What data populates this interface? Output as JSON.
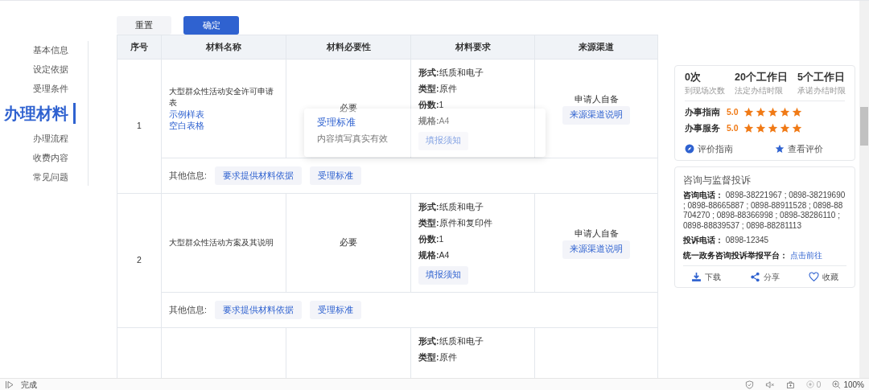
{
  "toolbar": {
    "buttons": [
      {
        "label": "重置",
        "kind": "secondary"
      },
      {
        "label": "确定",
        "kind": "primary"
      }
    ]
  },
  "sidebar": {
    "items": [
      {
        "label": "基本信息",
        "selected": false
      },
      {
        "label": "设定依据",
        "selected": false
      },
      {
        "label": "受理条件",
        "selected": false
      },
      {
        "label": "办理材料",
        "selected": true
      },
      {
        "label": "办理流程",
        "selected": false
      },
      {
        "label": "收费内容",
        "selected": false
      },
      {
        "label": "常见问题",
        "selected": false
      }
    ]
  },
  "table": {
    "columns": [
      "序号",
      "材料名称",
      "材料必要性",
      "材料要求",
      "来源渠道"
    ],
    "rows": [
      {
        "index": "1",
        "name": "大型群众性活动安全许可申请表",
        "links": [
          "示例样表",
          "空白表格"
        ],
        "necessity": "必要",
        "requirements": [
          "**形式:**纸质和电子",
          "**类型:**原件",
          "**份数:**1",
          "**规格:**A4"
        ],
        "requirement_button": "填报须知",
        "source": "申请人自备",
        "source_button": "来源渠道说明",
        "other_label": "其他信息:",
        "other_buttons": [
          "要求提供材料依据",
          "受理标准"
        ]
      },
      {
        "index": "2",
        "name": "大型群众性活动方案及其说明",
        "necessity": "必要",
        "requirements": [
          "**形式:**纸质和电子",
          "**类型:**原件和复印件",
          "**份数:**1",
          "**规格:**A4"
        ],
        "requirement_button": "填报须知",
        "source": "申请人自备",
        "source_button": "来源渠道说明",
        "other_label": "其他信息:",
        "other_buttons": [
          "要求提供材料依据",
          "受理标准"
        ]
      },
      {
        "requirements": [
          "**形式:**纸质和电子",
          "**类型:**原件"
        ]
      }
    ]
  },
  "tooltip": {
    "title": "受理标准",
    "text": "内容填写真实有效"
  },
  "summary": {
    "stats": [
      {
        "value": "0次",
        "label": "到现场次数"
      },
      {
        "value": "20个工作日",
        "label": "法定办结时限"
      },
      {
        "value": "5个工作日",
        "label": "承诺办结时限"
      }
    ],
    "ratings": [
      {
        "label": "办事指南",
        "score": "5.0",
        "stars": 5
      },
      {
        "label": "办事服务",
        "score": "5.0",
        "stars": 5
      }
    ],
    "links": [
      {
        "label": "评价指南"
      },
      {
        "label": "查看评价"
      }
    ]
  },
  "contact": {
    "title": "咨询与监督投诉",
    "lines": [
      {
        "label": "咨询电话：",
        "value": "0898-38221967 ; 0898-38219690 ; 0898-88665887 ; 0898-88911528 ; 0898-88704270 ; 0898-88366998 ; 0898-38286110 ; 0898-88839537 ; 0898-88281113"
      },
      {
        "label": "投诉电话：",
        "value": "0898-12345"
      },
      {
        "label": "统一政务咨询投诉举报平台：",
        "link": "点击前往"
      }
    ],
    "actions": [
      {
        "label": "下载"
      },
      {
        "label": "分享"
      },
      {
        "label": "收藏"
      }
    ]
  },
  "status_bar": {
    "text": "完成",
    "count": "0",
    "zoom": "100%"
  }
}
